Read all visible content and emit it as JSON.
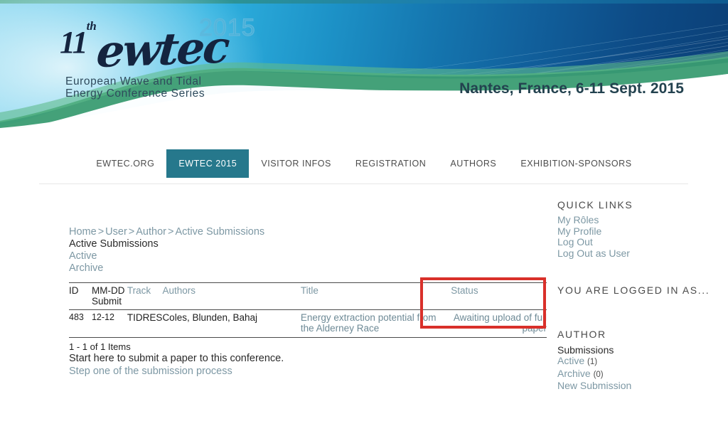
{
  "banner": {
    "logo": {
      "ordinal": "11",
      "ordinal_suffix": "th",
      "word": "ewtec",
      "year": "2015",
      "tagline_line1": "European Wave and Tidal",
      "tagline_line2": "Energy Conference Series"
    },
    "location_date": "Nantes, France,  6-11 Sept. 2015",
    "colors": {
      "gradient_light": "#8fd8ee",
      "gradient_dark": "#0b3f76",
      "wave_green": "#3a9c72",
      "logo_navy": "#14243f"
    }
  },
  "nav": {
    "items": [
      {
        "label": "EWTEC.ORG",
        "active": false
      },
      {
        "label": "EWTEC 2015",
        "active": true
      },
      {
        "label": "VISITOR INFOS",
        "active": false
      },
      {
        "label": "REGISTRATION",
        "active": false
      },
      {
        "label": "AUTHORS",
        "active": false
      },
      {
        "label": "EXHIBITION-SPONSORS",
        "active": false
      }
    ],
    "active_bg": "#26788c"
  },
  "breadcrumb": {
    "items": [
      "Home",
      "User",
      "Author",
      "Active Submissions"
    ],
    "separator": ">"
  },
  "main": {
    "page_title": "Active Submissions",
    "tabs": [
      {
        "label": "Active"
      },
      {
        "label": "Archive"
      }
    ],
    "table": {
      "headers": {
        "id": "ID",
        "date": "MM-DD Submit",
        "date_line1": "MM-DD",
        "date_line2": "Submit",
        "track": "Track",
        "authors": "Authors",
        "title": "Title",
        "status": "Status"
      },
      "rows": [
        {
          "id": "483",
          "date": "12-12",
          "track": "TIDRES",
          "authors": "Coles, Blunden, Bahaj",
          "title": "Energy extraction potential from the Alderney Race",
          "status": "Awaiting upload of full paper"
        }
      ]
    },
    "items_count": "1 - 1 of 1 Items",
    "start_text": "Start here to submit a paper to this conference.",
    "start_link": "Step one of the submission process"
  },
  "annotation": {
    "highlight_color": "#d9302a"
  },
  "sidebar": {
    "quick_links": {
      "heading": "QUICK LINKS",
      "items": [
        {
          "label": "My Rôles"
        },
        {
          "label": "My Profile"
        },
        {
          "label": "Log Out"
        },
        {
          "label": "Log Out as User"
        }
      ]
    },
    "logged_in": {
      "heading": "YOU ARE LOGGED IN AS..."
    },
    "author": {
      "heading": "AUTHOR",
      "static_label": "Submissions",
      "items": [
        {
          "label": "Active",
          "count": "(1)"
        },
        {
          "label": "Archive",
          "count": "(0)"
        },
        {
          "label": "New Submission",
          "count": ""
        }
      ]
    }
  }
}
